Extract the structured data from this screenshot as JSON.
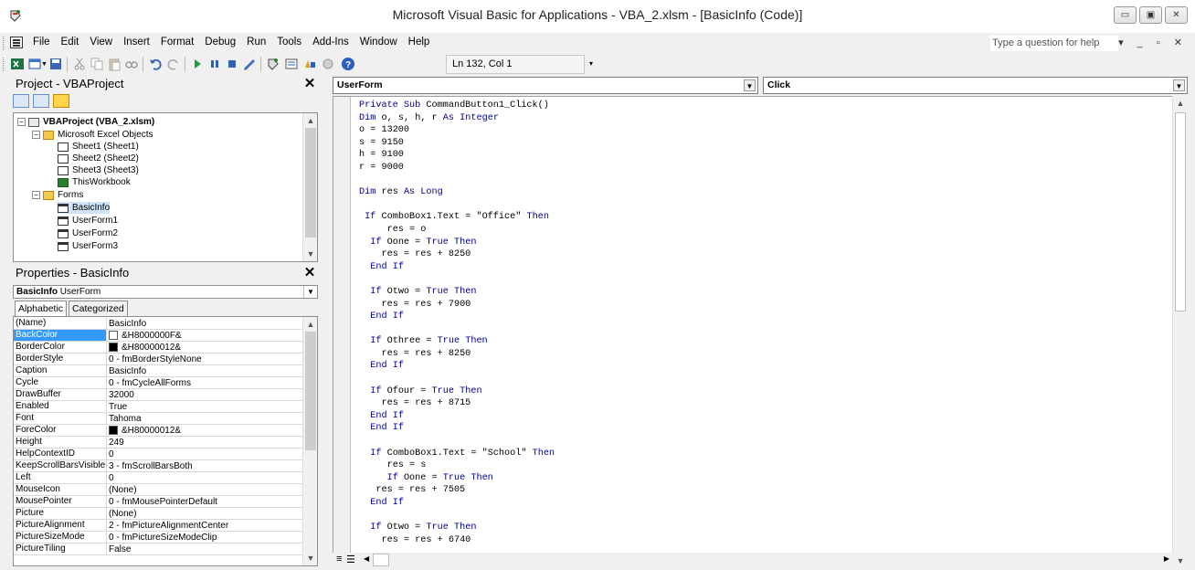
{
  "window": {
    "title": "Microsoft Visual Basic for Applications - VBA_2.xlsm - [BasicInfo (Code)]",
    "controls": [
      "▭",
      "▣",
      "✕"
    ]
  },
  "menu": {
    "items": [
      "File",
      "Edit",
      "View",
      "Insert",
      "Format",
      "Debug",
      "Run",
      "Tools",
      "Add-Ins",
      "Window",
      "Help"
    ],
    "help_placeholder": "Type a question for help",
    "mdi_controls": "▾ _ ▫ ✕"
  },
  "toolbar": {
    "position": "Ln 132, Col 1",
    "icons": [
      "excel-icon",
      "insert-userform-icon",
      "save-icon",
      "cut-icon",
      "copy-icon",
      "paste-icon",
      "find-icon",
      "undo-icon",
      "redo-icon",
      "run-icon",
      "break-icon",
      "reset-icon",
      "design-mode-icon",
      "project-explorer-icon",
      "properties-icon",
      "object-browser-icon",
      "toolbox-icon",
      "help-icon"
    ]
  },
  "project": {
    "title": "Project - VBAProject",
    "close": "✕",
    "tree": [
      {
        "label": "VBAProject (VBA_2.xlsm)",
        "level": 0,
        "bold": true,
        "icon": "project-icon",
        "expand": "−"
      },
      {
        "label": "Microsoft Excel Objects",
        "level": 1,
        "icon": "folder-icon",
        "expand": "−"
      },
      {
        "label": "Sheet1 (Sheet1)",
        "level": 2,
        "icon": "sheet-icon"
      },
      {
        "label": "Sheet2 (Sheet2)",
        "level": 2,
        "icon": "sheet-icon"
      },
      {
        "label": "Sheet3 (Sheet3)",
        "level": 2,
        "icon": "sheet-icon"
      },
      {
        "label": "ThisWorkbook",
        "level": 2,
        "icon": "workbook-icon"
      },
      {
        "label": "Forms",
        "level": 1,
        "icon": "folder-icon",
        "expand": "−"
      },
      {
        "label": "BasicInfo",
        "level": 2,
        "icon": "form-icon",
        "selected": true
      },
      {
        "label": "UserForm1",
        "level": 2,
        "icon": "form-icon"
      },
      {
        "label": "UserForm2",
        "level": 2,
        "icon": "form-icon"
      },
      {
        "label": "UserForm3",
        "level": 2,
        "icon": "form-icon"
      }
    ]
  },
  "properties": {
    "title": "Properties - BasicInfo",
    "close": "✕",
    "object_name": "BasicInfo",
    "object_type": "UserForm",
    "tabs": [
      "Alphabetic",
      "Categorized"
    ],
    "rows": [
      {
        "name": "(Name)",
        "value": "BasicInfo"
      },
      {
        "name": "BackColor",
        "value": "&H8000000F&",
        "swatch": "#ffffff",
        "selected": true
      },
      {
        "name": "BorderColor",
        "value": "&H80000012&",
        "swatch": "#000000"
      },
      {
        "name": "BorderStyle",
        "value": "0 - fmBorderStyleNone"
      },
      {
        "name": "Caption",
        "value": "BasicInfo"
      },
      {
        "name": "Cycle",
        "value": "0 - fmCycleAllForms"
      },
      {
        "name": "DrawBuffer",
        "value": "32000"
      },
      {
        "name": "Enabled",
        "value": "True"
      },
      {
        "name": "Font",
        "value": "Tahoma"
      },
      {
        "name": "ForeColor",
        "value": "&H80000012&",
        "swatch": "#000000"
      },
      {
        "name": "Height",
        "value": "249"
      },
      {
        "name": "HelpContextID",
        "value": "0"
      },
      {
        "name": "KeepScrollBarsVisible",
        "value": "3 - fmScrollBarsBoth"
      },
      {
        "name": "Left",
        "value": "0"
      },
      {
        "name": "MouseIcon",
        "value": "(None)"
      },
      {
        "name": "MousePointer",
        "value": "0 - fmMousePointerDefault"
      },
      {
        "name": "Picture",
        "value": "(None)"
      },
      {
        "name": "PictureAlignment",
        "value": "2 - fmPictureAlignmentCenter"
      },
      {
        "name": "PictureSizeMode",
        "value": "0 - fmPictureSizeModeClip"
      },
      {
        "name": "PictureTiling",
        "value": "False"
      }
    ]
  },
  "code": {
    "object_combo": "UserForm",
    "procedure_combo": "Click",
    "lines": [
      "Private Sub CommandButton1_Click()",
      "Dim o, s, h, r As Integer",
      "o = 13200",
      "s = 9150",
      "h = 9100",
      "r = 9000",
      "",
      "Dim res As Long",
      "",
      " If ComboBox1.Text = \"Office\" Then",
      "     res = o",
      "  If Oone = True Then",
      "    res = res + 8250",
      "  End If",
      "",
      "  If Otwo = True Then",
      "    res = res + 7900",
      "  End If",
      "",
      "  If Othree = True Then",
      "    res = res + 8250",
      "  End If",
      "",
      "  If Ofour = True Then",
      "    res = res + 8715",
      "  End If",
      "  End If",
      "",
      "  If ComboBox1.Text = \"School\" Then",
      "     res = s",
      "     If Oone = True Then",
      "   res = res + 7505",
      "  End If",
      "",
      "  If Otwo = True Then",
      "    res = res + 6740"
    ]
  },
  "colors": {
    "keyword": "#00008b",
    "selection": "#3399ff",
    "tree_selection": "#cfe3fb"
  }
}
